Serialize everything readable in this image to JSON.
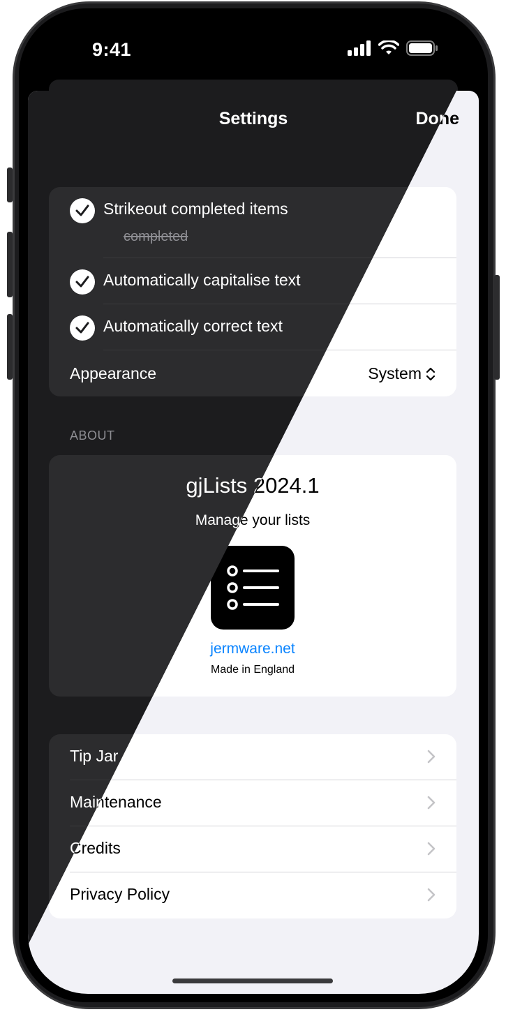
{
  "status_bar": {
    "time": "9:41"
  },
  "nav": {
    "title": "Settings",
    "done_label": "Done"
  },
  "settings": {
    "strikeout_label": "Strikeout completed items",
    "strikeout_sample": "completed",
    "capitalise_label": "Automatically capitalise text",
    "autocorrect_label": "Automatically correct text",
    "appearance_label": "Appearance",
    "appearance_value": "System"
  },
  "about": {
    "section_header": "ABOUT",
    "title": "gjLists 2024.1",
    "tagline": "Manage your lists",
    "link": "jermware.net",
    "made_in": "Made in England"
  },
  "links": {
    "tip_jar": "Tip Jar",
    "maintenance": "Maintenance",
    "credits": "Credits",
    "privacy": "Privacy Policy"
  },
  "icons": {
    "check": "checkmark-circle-icon",
    "updown": "chevron-up-down-icon",
    "chevron": "chevron-right-icon",
    "app": "list-bullets-icon"
  },
  "colors": {
    "link": "#0a84ff",
    "dark_bg": "#1c1c1e",
    "light_bg": "#f2f2f7"
  }
}
